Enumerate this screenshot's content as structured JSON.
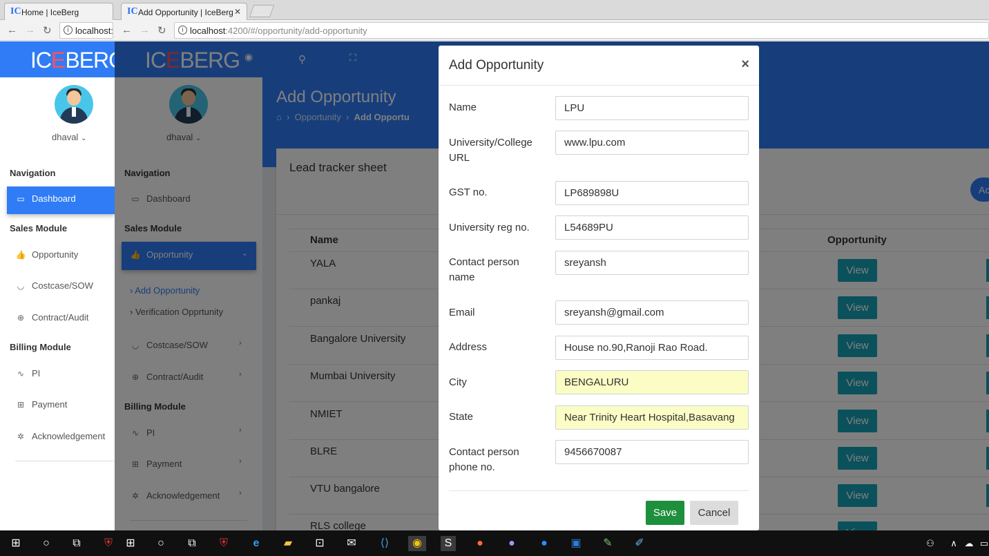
{
  "browser": {
    "tabs": [
      {
        "label": "Home | IceBerg",
        "favicon": "ICE"
      },
      {
        "label": "Add Opportunity | IceBerg",
        "favicon": "ICE"
      }
    ],
    "back_url": "localhost:",
    "url_host": "localhost",
    "url_path": ":4200/#/opportunity/add-opportunity"
  },
  "app": {
    "brand_pre": "IC",
    "brand_mid": "E",
    "brand_post": "BERG",
    "accent": "#2f7cf6",
    "user": "dhaval"
  },
  "sidebar": {
    "nav_title": "Navigation",
    "dashboard": "Dashboard",
    "sales_title": "Sales Module",
    "opportunity": "Opportunity",
    "add_opportunity": "Add Opportunity",
    "verification": "Verification Opprtunity",
    "costcase": "Costcase/SOW",
    "contract": "Contract/Audit",
    "billing_title": "Billing Module",
    "pi": "PI",
    "payment": "Payment",
    "ack": "Acknowledgement"
  },
  "page": {
    "title": "Add Opportunity",
    "crumb_1": "Opportunity",
    "crumb_2": "Add Opportu",
    "card_title": "Lead tracker sheet",
    "add_button": "Ac",
    "col_name": "Name",
    "col_opportunity": "Opportunity",
    "view_label": "View",
    "rows": [
      "YALA",
      "pankaj",
      "Bangalore University",
      "Mumbai University",
      "NMIET",
      "BLRE",
      "VTU bangalore",
      "RLS college"
    ]
  },
  "modal": {
    "title": "Add Opportunity",
    "close": "×",
    "fields": [
      {
        "label": "Name",
        "value": "LPU"
      },
      {
        "label": "University/College URL",
        "value": "www.lpu.com"
      },
      {
        "label": "GST no.",
        "value": "LP689898U"
      },
      {
        "label": "University reg no.",
        "value": "L54689PU"
      },
      {
        "label": "Contact person name",
        "value": "sreyansh"
      },
      {
        "label": "Email",
        "value": "sreyansh@gmail.com"
      },
      {
        "label": "Address",
        "value": "House no.90,Ranoji Rao Road."
      },
      {
        "label": "City",
        "value": "BENGALURU"
      },
      {
        "label": "State",
        "value": "Near Trinity Heart Hospital,Basavang"
      },
      {
        "label": "Contact person phone no.",
        "value": "9456670087"
      }
    ],
    "save": "Save",
    "cancel": "Cancel"
  }
}
